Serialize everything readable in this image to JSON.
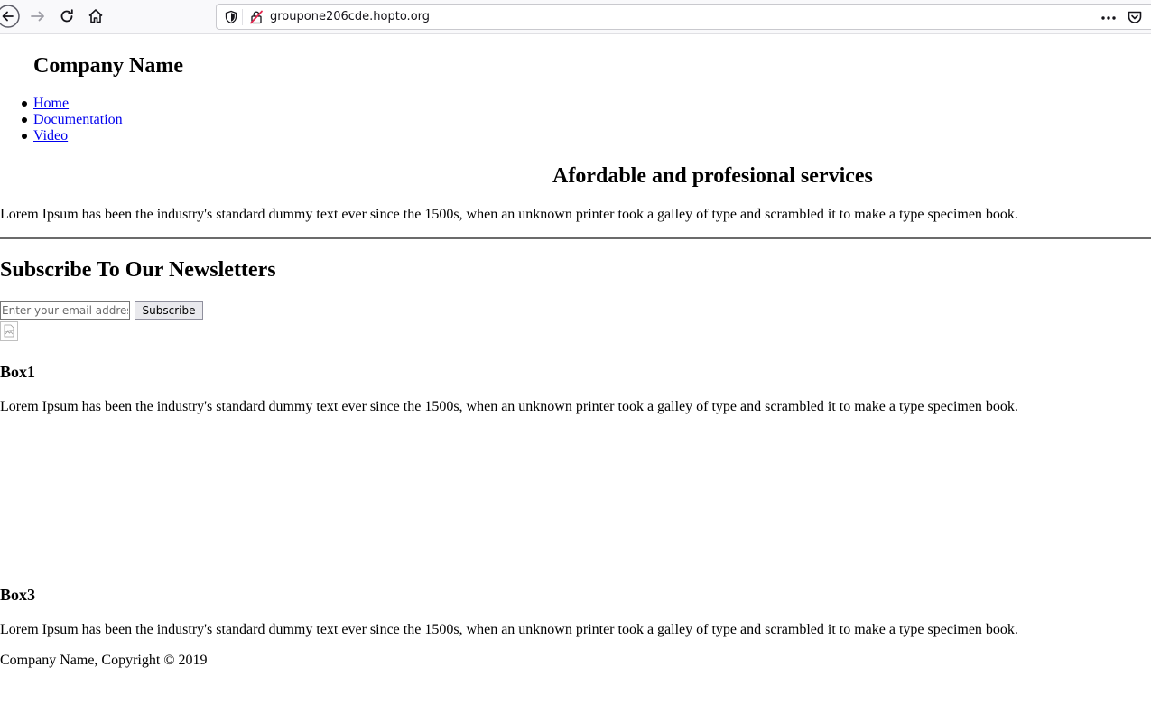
{
  "browser": {
    "url": "groupone206cde.hopto.org"
  },
  "page": {
    "company_name": "Company Name",
    "nav": [
      {
        "label": "Home"
      },
      {
        "label": "Documentation"
      },
      {
        "label": "Video"
      }
    ],
    "hero": {
      "title": "Afordable and profesional services",
      "text": "Lorem Ipsum has been the industry's standard dummy text ever since the 1500s, when an unknown printer took a galley of type and scrambled it to make a type specimen book."
    },
    "newsletter": {
      "title": "Subscribe To Our Newsletters",
      "email_placeholder": "Enter your email address",
      "button_label": "Subscribe"
    },
    "box1": {
      "title": "Box1",
      "text": "Lorem Ipsum has been the industry's standard dummy text ever since the 1500s, when an unknown printer took a galley of type and scrambled it to make a type specimen book."
    },
    "box3": {
      "title": "Box3",
      "text": "Lorem Ipsum has been the industry's standard dummy text ever since the 1500s, when an unknown printer took a galley of type and scrambled it to make a type specimen book."
    },
    "footer": "Company Name, Copyright © 2019"
  }
}
